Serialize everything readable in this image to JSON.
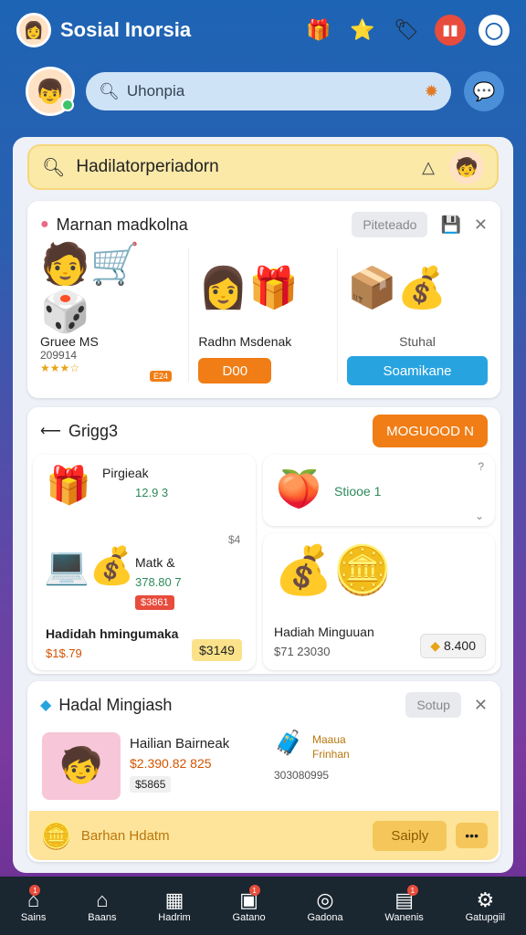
{
  "app": {
    "title": "Sosial Inorsia"
  },
  "search": {
    "value": "Uhonpia"
  },
  "hero": {
    "text": "Hadilatorperiadorn"
  },
  "card1": {
    "title": "Marnan madkolna",
    "pill": "Piteteado",
    "items": [
      {
        "name": "Gruee MS",
        "sub": "209914",
        "tag": "E24"
      },
      {
        "name": "Radhn Msdenak",
        "button": "D00"
      },
      {
        "name": "Stuhal",
        "button": "Soamikane"
      }
    ]
  },
  "card2": {
    "title": "Grigg3",
    "button": "MOGUOOD N",
    "left_top": {
      "title": "Pirgieak",
      "value": "12.9 3"
    },
    "left_note": "$4",
    "left_mid": {
      "title": "Matk &",
      "value": "378.80 7",
      "tag": "$3861"
    },
    "left_bottom": {
      "title": "Hadidah hmingumaka",
      "value": "$1$.79",
      "price": "$3149"
    },
    "right_top": {
      "label": "Stiooe 1"
    },
    "right_bottom": {
      "title": "Hadiah Minguuan",
      "value": "$71 23030",
      "price": "8.400"
    }
  },
  "card3": {
    "title": "Hadal Mingiash",
    "pill": "Sotup",
    "item1": {
      "title": "Hailian Bairneak",
      "value": "$2.390.82 825",
      "tag": "$5865"
    },
    "item2": {
      "title": "Maaua Frinhan",
      "value": "303080995"
    },
    "footer_text": "Barhan Hdatm",
    "footer_button": "Saiply"
  },
  "nav": [
    {
      "label": "Sains",
      "icon": "home-icon",
      "badge": "1"
    },
    {
      "label": "Baans",
      "icon": "house-icon"
    },
    {
      "label": "Hadrim",
      "icon": "grid-icon"
    },
    {
      "label": "Gatano",
      "icon": "image-icon",
      "badge": "1"
    },
    {
      "label": "Gadona",
      "icon": "compass-icon"
    },
    {
      "label": "Wanenis",
      "icon": "cart-icon",
      "badge": "1"
    },
    {
      "label": "Gatupgiil",
      "icon": "gear-icon"
    }
  ]
}
